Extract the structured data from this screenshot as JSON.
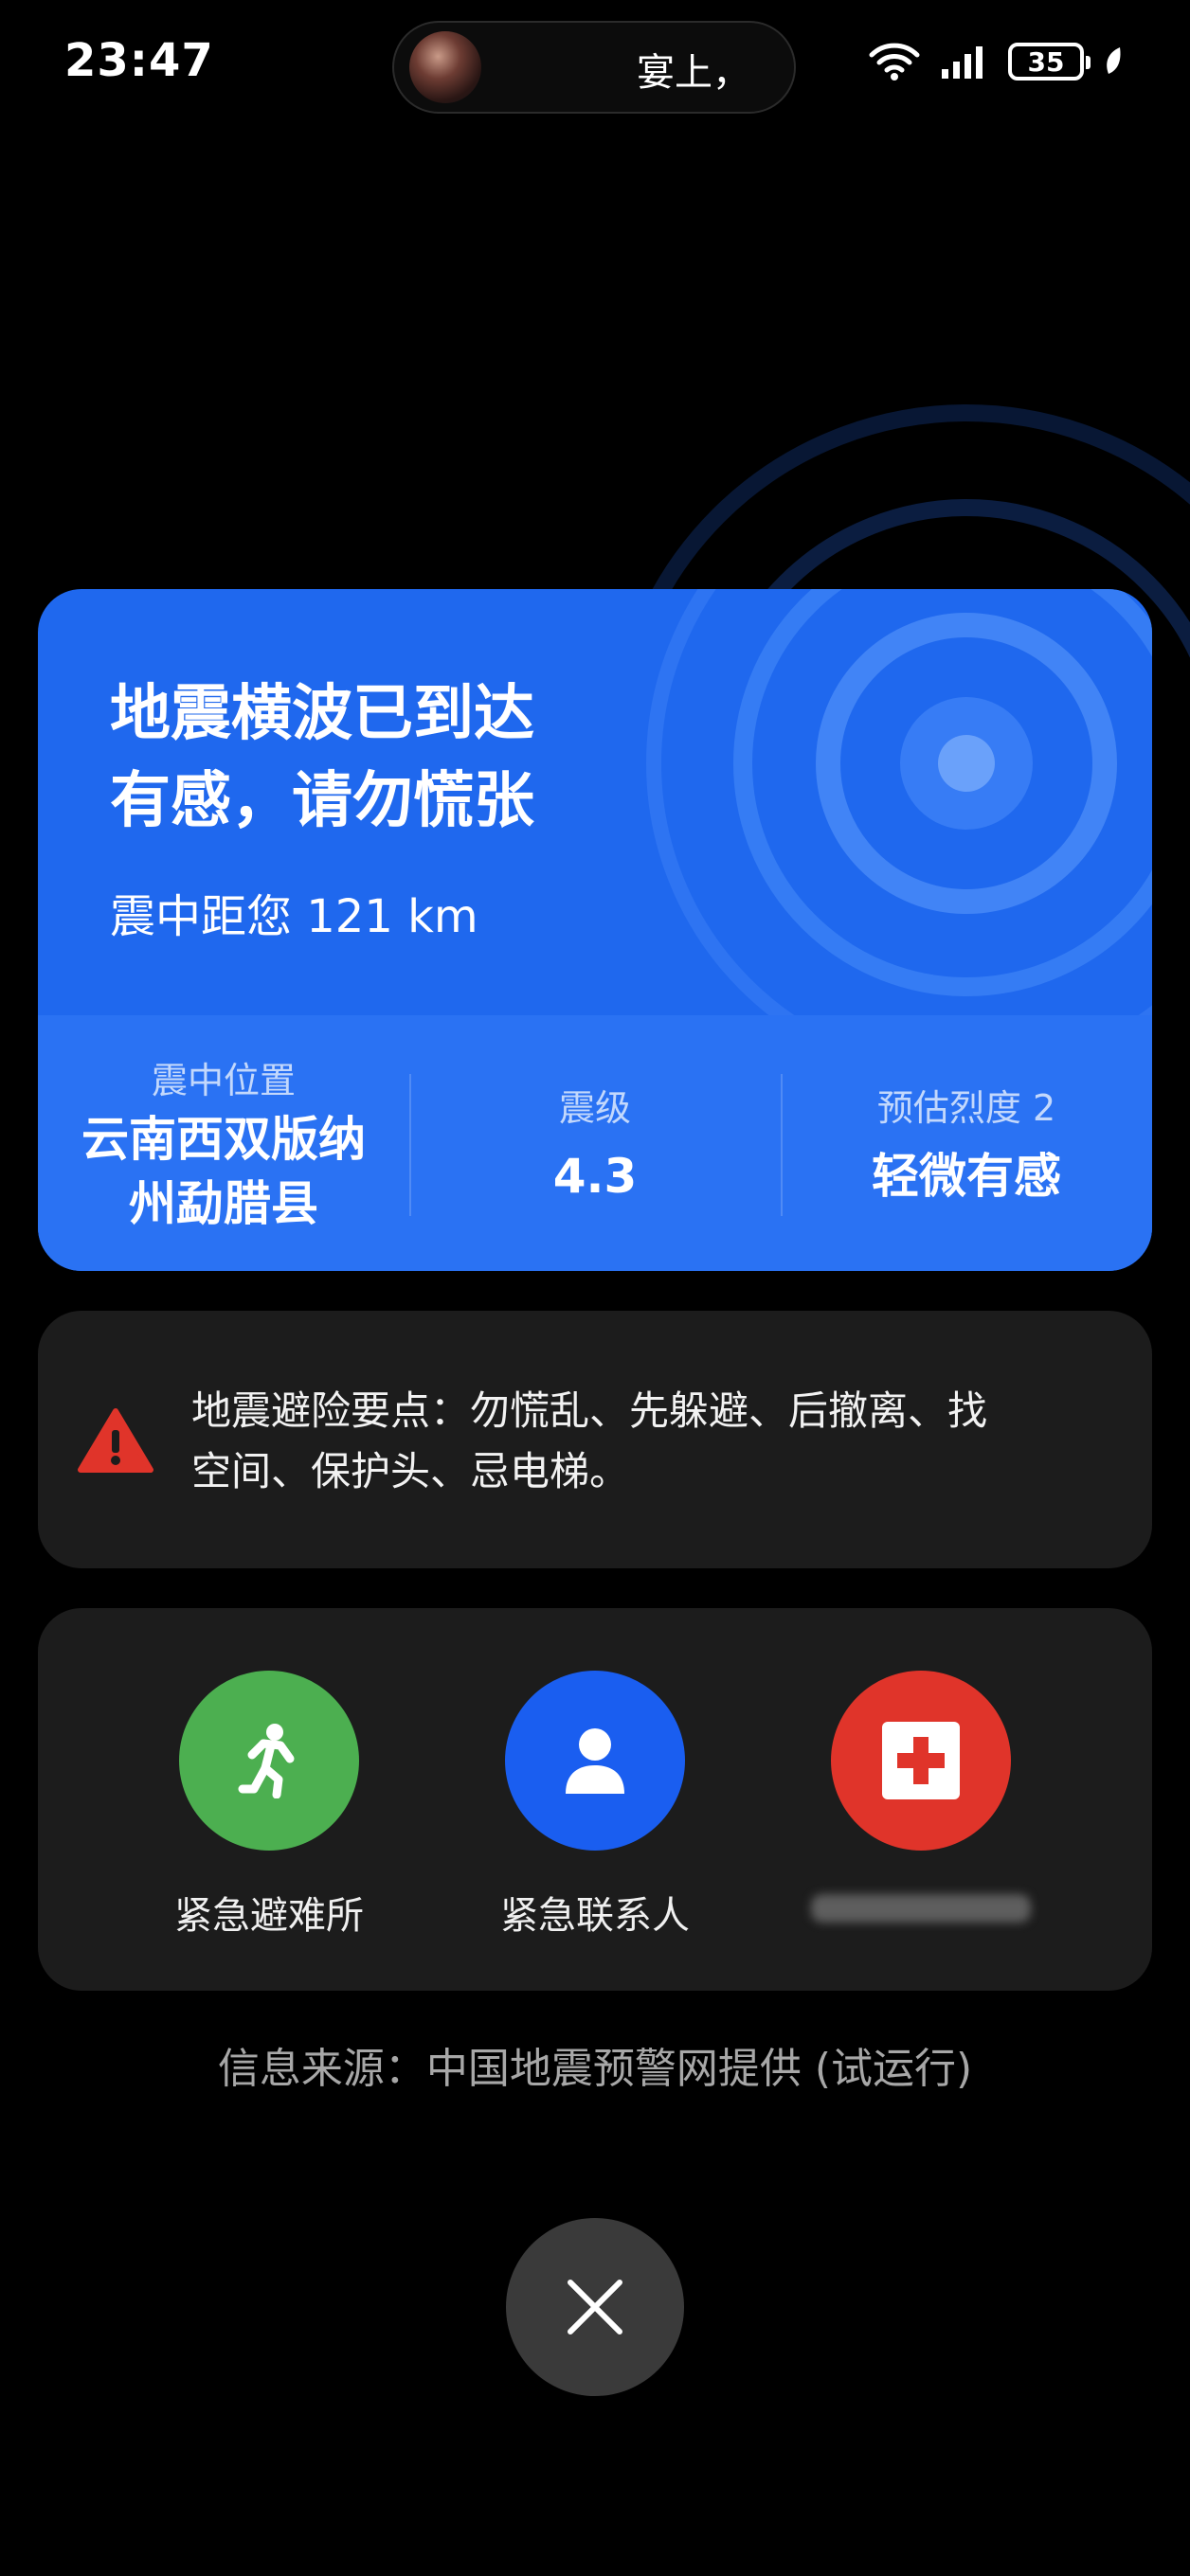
{
  "status_bar": {
    "time": "23:47",
    "island_text": "宴上，",
    "battery": "35"
  },
  "alert": {
    "title_line1": "地震横波已到达",
    "title_line2": "有感，请勿慌张",
    "distance": "震中距您 121 km",
    "background_color": "#1f68ee"
  },
  "details": {
    "epicenter_label": "震中位置",
    "epicenter_line1": "云南西双版纳",
    "epicenter_line2": "州勐腊县",
    "magnitude_label": "震级",
    "magnitude_value": "4.3",
    "intensity_label": "预估烈度 2",
    "intensity_value": "轻微有感"
  },
  "tips": {
    "line1": "地震避险要点：勿慌乱、先躲避、后撤离、找",
    "line2": "空间、保护头、忌电梯。",
    "warning_color": "#e0342a"
  },
  "actions": [
    {
      "label": "紧急避难所",
      "icon": "running-person-icon",
      "color": "#4caf50"
    },
    {
      "label": "紧急联系人",
      "icon": "person-icon",
      "color": "#1a5ef0"
    },
    {
      "label": "",
      "icon": "first-aid-icon",
      "color": "#e0342a"
    }
  ],
  "footer": {
    "source": "信息来源：中国地震预警网提供 (试运行)",
    "close_icon": "close-icon"
  }
}
